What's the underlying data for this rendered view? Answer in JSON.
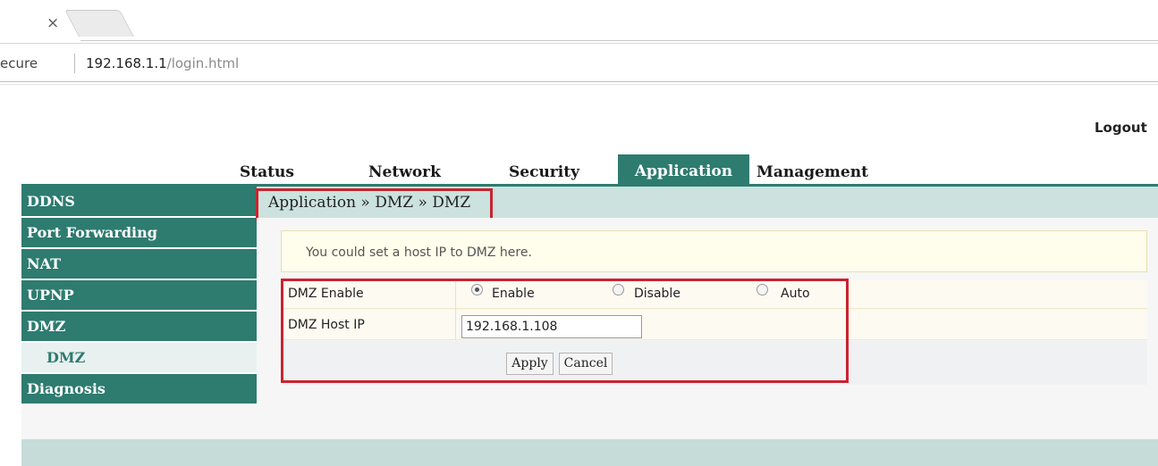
{
  "browser": {
    "tab": {
      "close_glyph": "×"
    },
    "address": {
      "security_label": "ecure",
      "host": "192.168.1.1",
      "path": "/login.html"
    }
  },
  "router": {
    "logout_label": "Logout",
    "topnav": [
      {
        "label": "Status",
        "active": false
      },
      {
        "label": "Network",
        "active": false
      },
      {
        "label": "Security",
        "active": false
      },
      {
        "label": "Application",
        "active": true
      },
      {
        "label": "Management",
        "active": false
      }
    ],
    "sidebar": [
      {
        "label": "DDNS",
        "sub": false
      },
      {
        "label": "Port Forwarding",
        "sub": false
      },
      {
        "label": "NAT",
        "sub": false
      },
      {
        "label": "UPNP",
        "sub": false
      },
      {
        "label": "DMZ",
        "sub": false
      },
      {
        "label": "DMZ",
        "sub": true,
        "selected": true
      },
      {
        "label": "Diagnosis",
        "sub": false
      }
    ],
    "breadcrumb": "Application » DMZ » DMZ",
    "notice": "You could set a host IP to DMZ here.",
    "form": {
      "enable_field_label": "DMZ Enable",
      "enable_options": [
        {
          "label": "Enable",
          "selected": true
        },
        {
          "label": "Disable",
          "selected": false
        },
        {
          "label": "Auto",
          "selected": false
        }
      ],
      "host_ip_label": "DMZ Host IP",
      "host_ip_value": "192.168.1.108",
      "apply_label": "Apply",
      "cancel_label": "Cancel"
    }
  },
  "colors": {
    "accent": "#2e7b70",
    "highlight_box": "#c8242f"
  }
}
